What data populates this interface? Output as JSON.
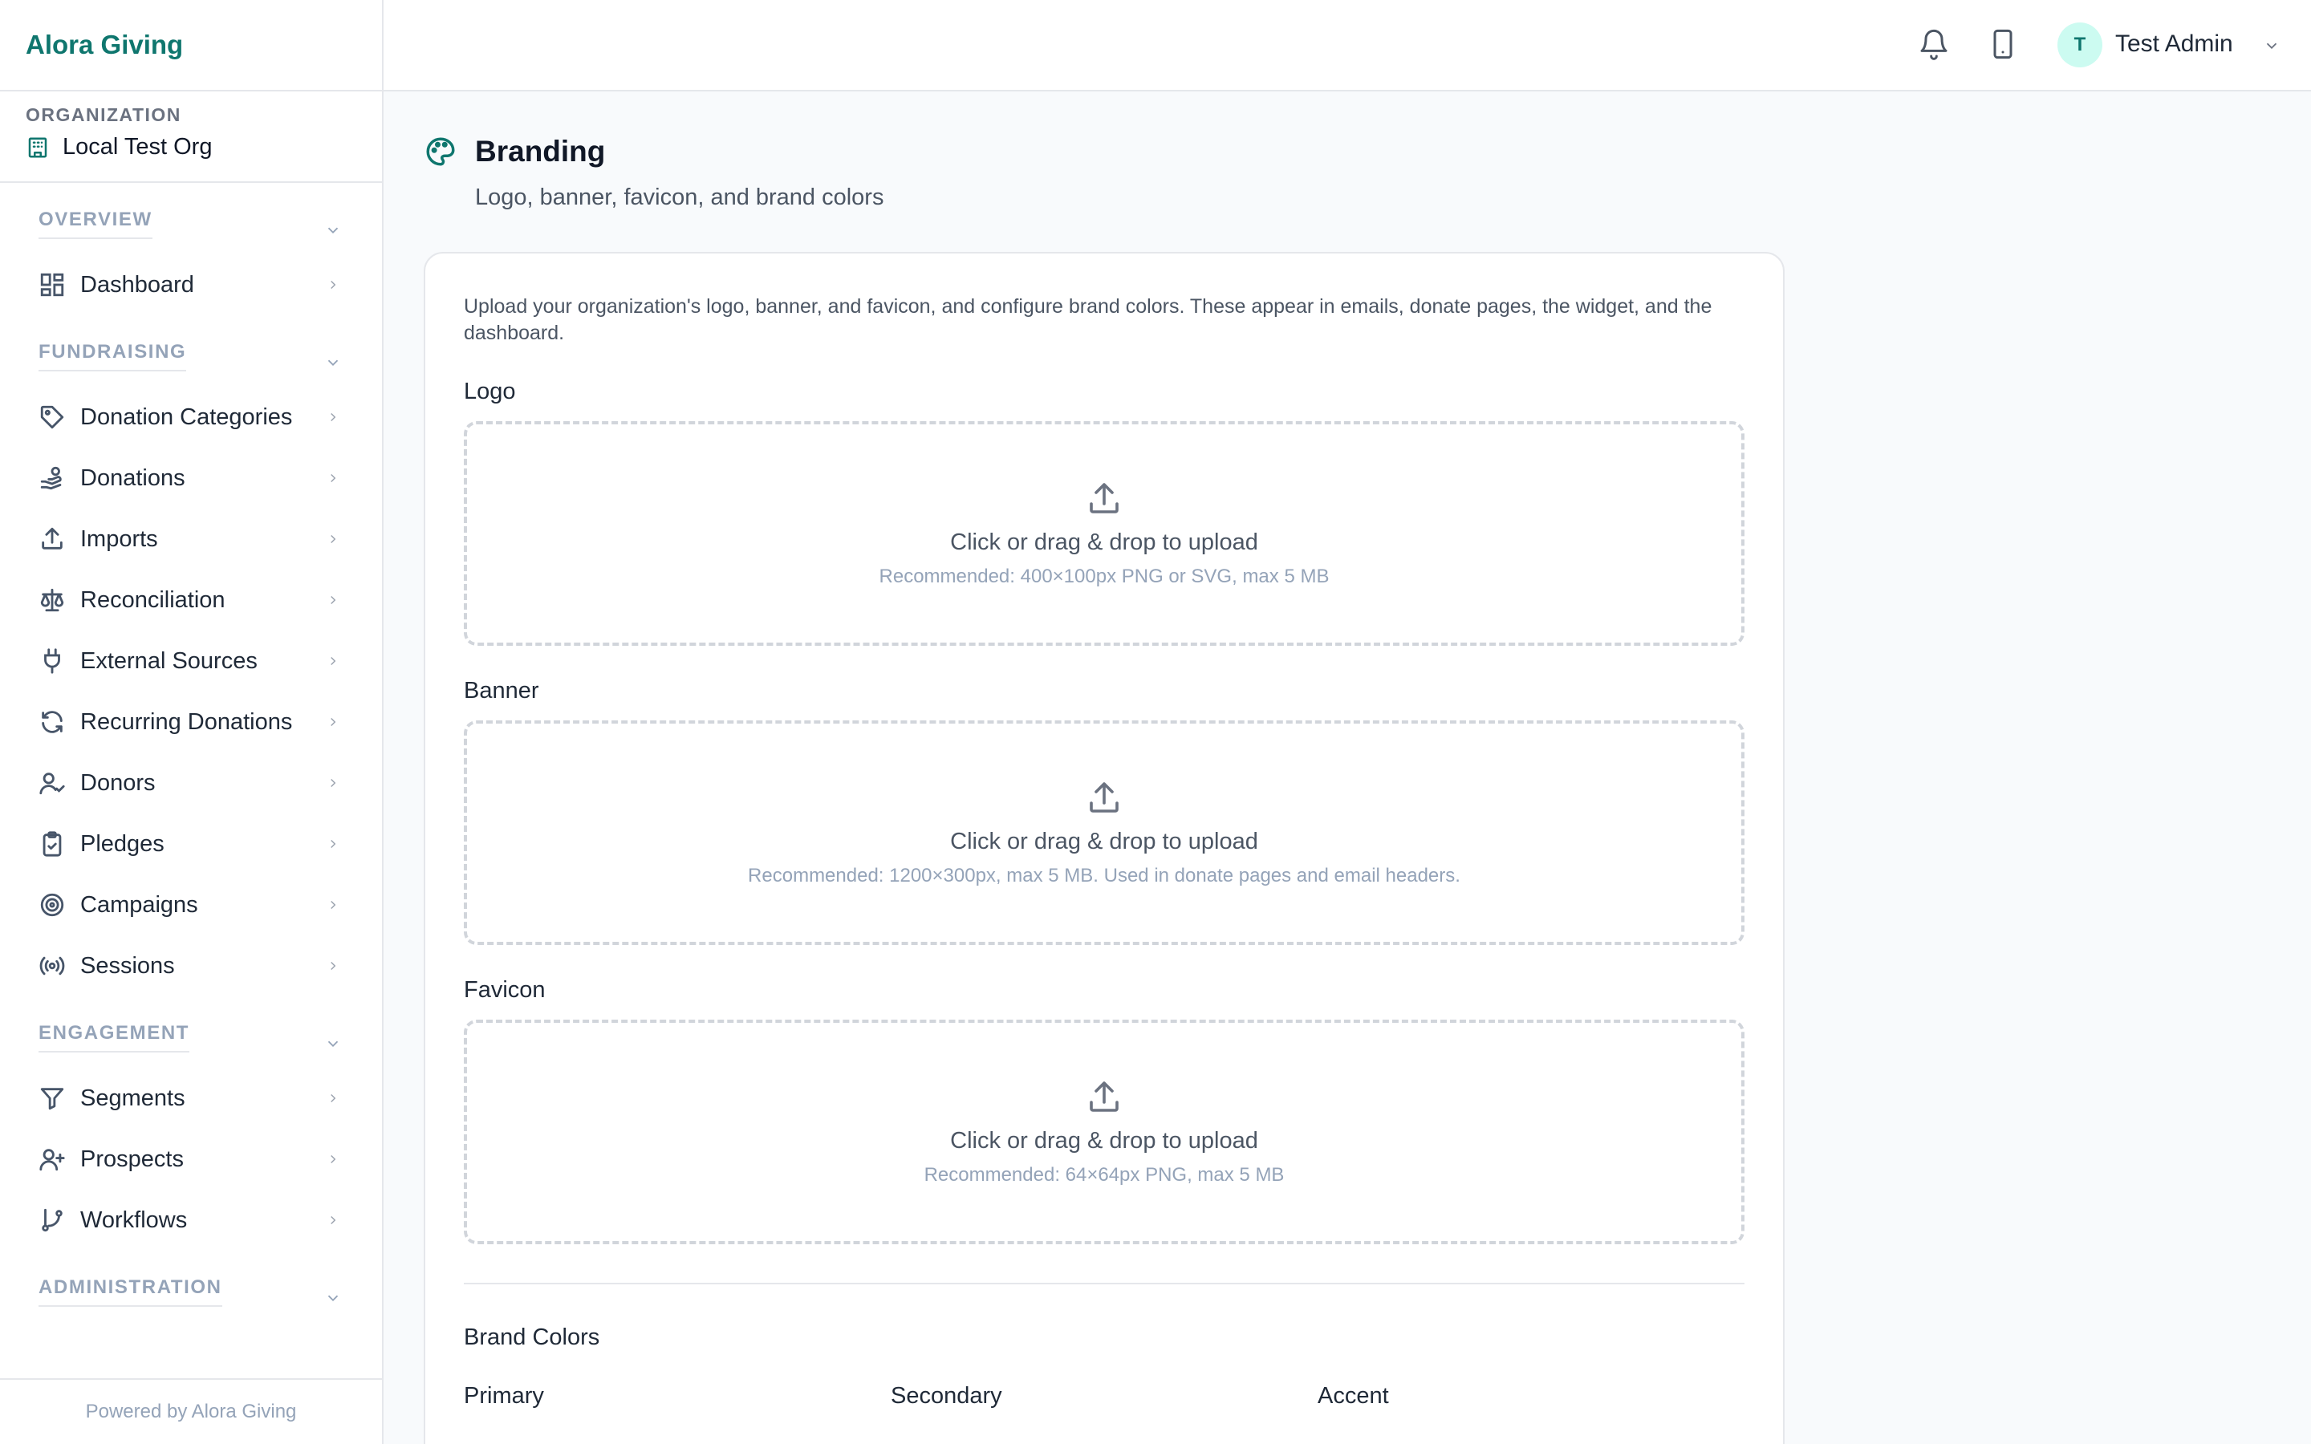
{
  "app": {
    "name": "Alora Giving"
  },
  "organization": {
    "label": "ORGANIZATION",
    "name": "Local Test Org"
  },
  "sidebar": {
    "sections": [
      {
        "title": "OVERVIEW",
        "items": [
          {
            "label": "Dashboard",
            "icon": "dashboard-icon"
          }
        ]
      },
      {
        "title": "FUNDRAISING",
        "items": [
          {
            "label": "Donation Categories",
            "icon": "tag-icon"
          },
          {
            "label": "Donations",
            "icon": "hand-coins-icon"
          },
          {
            "label": "Imports",
            "icon": "upload-icon"
          },
          {
            "label": "Reconciliation",
            "icon": "scale-icon"
          },
          {
            "label": "External Sources",
            "icon": "plug-icon"
          },
          {
            "label": "Recurring Donations",
            "icon": "refresh-icon"
          },
          {
            "label": "Donors",
            "icon": "user-check-icon"
          },
          {
            "label": "Pledges",
            "icon": "clipboard-check-icon"
          },
          {
            "label": "Campaigns",
            "icon": "target-icon"
          },
          {
            "label": "Sessions",
            "icon": "radio-icon"
          }
        ]
      },
      {
        "title": "ENGAGEMENT",
        "items": [
          {
            "label": "Segments",
            "icon": "filter-icon"
          },
          {
            "label": "Prospects",
            "icon": "user-plus-icon"
          },
          {
            "label": "Workflows",
            "icon": "git-branch-icon"
          }
        ]
      },
      {
        "title": "ADMINISTRATION",
        "items": []
      }
    ],
    "footer": "Powered by Alora Giving"
  },
  "header": {
    "user_initial": "T",
    "user_name": "Test Admin"
  },
  "page": {
    "title": "Branding",
    "subtitle": "Logo, banner, favicon, and brand colors",
    "description": "Upload your organization's logo, banner, and favicon, and configure brand colors. These appear in emails, donate pages, the widget, and the dashboard.",
    "uploads": [
      {
        "label": "Logo",
        "title": "Click or drag & drop to upload",
        "hint": "Recommended: 400×100px PNG or SVG, max 5 MB"
      },
      {
        "label": "Banner",
        "title": "Click or drag & drop to upload",
        "hint": "Recommended: 1200×300px, max 5 MB. Used in donate pages and email headers."
      },
      {
        "label": "Favicon",
        "title": "Click or drag & drop to upload",
        "hint": "Recommended: 64×64px PNG, max 5 MB"
      }
    ],
    "brand_colors": {
      "title": "Brand Colors",
      "primary": "Primary",
      "secondary": "Secondary",
      "accent": "Accent"
    }
  },
  "colors": {
    "brand": "#0f766e",
    "muted": "#94a3b8"
  }
}
